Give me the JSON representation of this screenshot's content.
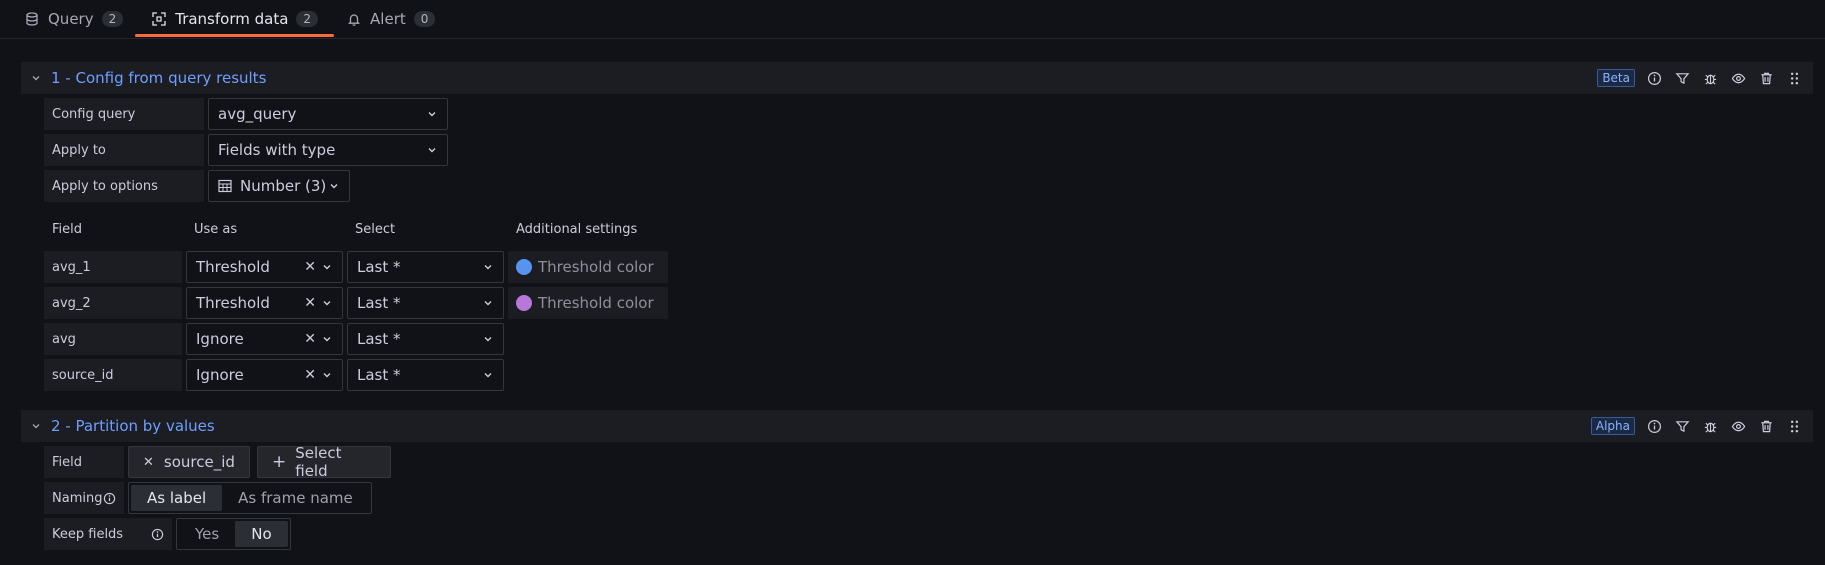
{
  "tabs": [
    {
      "label": "Query",
      "count": "2",
      "icon": "database-icon"
    },
    {
      "label": "Transform data",
      "count": "2",
      "icon": "transform-icon"
    },
    {
      "label": "Alert",
      "count": "0",
      "icon": "bell-icon"
    }
  ],
  "active_tab": 1,
  "accent_color": "#ff6a3d",
  "section1": {
    "title": "1 - Config from query results",
    "badge": "Beta",
    "config_query_label": "Config query",
    "config_query_value": "avg_query",
    "apply_to_label": "Apply to",
    "apply_to_value": "Fields with type",
    "apply_to_options_label": "Apply to options",
    "apply_to_options_value": "Number (3)",
    "columns": {
      "field": "Field",
      "use_as": "Use as",
      "select": "Select",
      "additional": "Additional settings"
    },
    "rows": [
      {
        "field": "avg_1",
        "use_as": "Threshold",
        "select": "Last *",
        "color_label": "Threshold color",
        "color": "#5794f2"
      },
      {
        "field": "avg_2",
        "use_as": "Threshold",
        "select": "Last *",
        "color_label": "Threshold color",
        "color": "#b877d9"
      },
      {
        "field": "avg",
        "use_as": "Ignore",
        "select": "Last *"
      },
      {
        "field": "source_id",
        "use_as": "Ignore",
        "select": "Last *"
      }
    ]
  },
  "section2": {
    "title": "2 - Partition by values",
    "badge": "Alpha",
    "field_label": "Field",
    "field_value": "source_id",
    "select_field_label": "Select field",
    "naming_label": "Naming",
    "naming_options": [
      "As label",
      "As frame name"
    ],
    "keep_fields_label": "Keep fields",
    "keep_fields_options": [
      "Yes",
      "No"
    ]
  }
}
